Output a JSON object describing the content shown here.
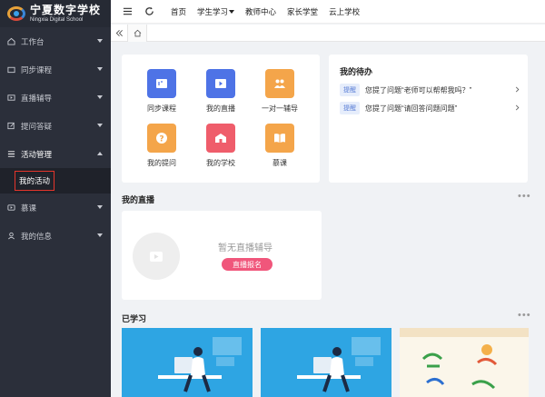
{
  "sidebar": {
    "logo_cn": "宁夏数字学校",
    "logo_en": "Ningxia Digital School",
    "items": [
      {
        "label": "工作台",
        "icon": "home-icon"
      },
      {
        "label": "同步课程",
        "icon": "folder-icon"
      },
      {
        "label": "直播辅导",
        "icon": "video-icon"
      },
      {
        "label": "提问答疑",
        "icon": "edit-icon"
      },
      {
        "label": "活动管理",
        "icon": "grid-icon"
      },
      {
        "label": "慕课",
        "icon": "play-icon"
      },
      {
        "label": "我的信息",
        "icon": "user-icon"
      }
    ],
    "submenu_active": "我的活动"
  },
  "topbar": {
    "nav": [
      "首页",
      "学生学习",
      "教师中心",
      "家长学堂",
      "云上学校"
    ]
  },
  "shortcuts": [
    {
      "label": "同步课程",
      "color": "#4e73e6",
      "icon": "course-icon"
    },
    {
      "label": "我的直播",
      "color": "#4e73e6",
      "icon": "live-icon"
    },
    {
      "label": "一对一辅导",
      "color": "#f4a54a",
      "icon": "tutor-icon"
    },
    {
      "label": "我的提问",
      "color": "#f4a54a",
      "icon": "question-icon"
    },
    {
      "label": "我的学校",
      "color": "#ef5d6b",
      "icon": "school-icon"
    },
    {
      "label": "慕课",
      "color": "#f4a54a",
      "icon": "book-icon"
    }
  ],
  "todo": {
    "title": "我的待办",
    "items": [
      {
        "tag": "提醒",
        "text": "您提了问题“老师可以帮帮我吗？”"
      },
      {
        "tag": "提醒",
        "text": "您提了问题“请回答问题问题”"
      }
    ]
  },
  "live": {
    "title": "我的直播",
    "empty_text": "暂无直播辅导",
    "button": "直播报名"
  },
  "learned": {
    "title": "已学习"
  },
  "colors": {
    "sidebar_bg": "#2b2f3a",
    "accent_red": "#e5352b",
    "button_pink": "#f0567b",
    "tag_blue": "#5b7fd6"
  }
}
